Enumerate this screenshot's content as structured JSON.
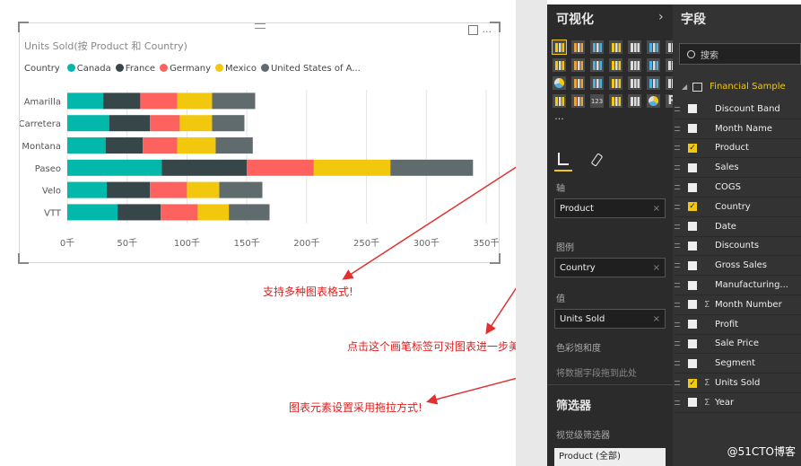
{
  "card": {
    "title": "Units Sold(按 Product 和 Country)",
    "legend_label": "Country",
    "legend": [
      {
        "name": "Canada",
        "color": "#01b8aa"
      },
      {
        "name": "France",
        "color": "#374649"
      },
      {
        "name": "Germany",
        "color": "#fd625e"
      },
      {
        "name": "Mexico",
        "color": "#f2c80f"
      },
      {
        "name": "United States of A...",
        "color": "#5f6b6d"
      }
    ],
    "focus_icon": "focus-mode-icon",
    "more_label": "···"
  },
  "chart_data": {
    "type": "bar",
    "orientation": "horizontal",
    "stacked": true,
    "categories": [
      "Amarilla",
      "Carretera",
      "Montana",
      "Paseo",
      "Velo",
      "VTT"
    ],
    "series": [
      {
        "name": "Canada",
        "color": "#01b8aa",
        "values": [
          30,
          35,
          32,
          79,
          33,
          42
        ]
      },
      {
        "name": "France",
        "color": "#374649",
        "values": [
          31,
          34,
          31,
          71,
          36,
          36
        ]
      },
      {
        "name": "Germany",
        "color": "#fd625e",
        "values": [
          31,
          25,
          29,
          56,
          31,
          31
        ]
      },
      {
        "name": "Mexico",
        "color": "#f2c80f",
        "values": [
          29,
          27,
          32,
          64,
          27,
          26
        ]
      },
      {
        "name": "United States of America",
        "color": "#5f6b6d",
        "values": [
          36,
          27,
          31,
          69,
          36,
          34
        ]
      }
    ],
    "xlim": [
      0,
      350
    ],
    "xticks": [
      "0千",
      "50千",
      "100千",
      "150千",
      "200千",
      "250千",
      "300千",
      "350千"
    ],
    "grid": true
  },
  "annotations": {
    "a1": "支持多种图表格式!",
    "a2": "点击这个画笔标签可对图表进一步美化!",
    "a3": "图表元素设置采用拖拉方式!"
  },
  "viz_pane": {
    "title": "可视化",
    "chevron": "›",
    "axis_label": "轴",
    "axis_value": "Product",
    "legend_label": "图例",
    "legend_value": "Country",
    "value_label": "值",
    "value_value": "Units Sold",
    "saturation_label": "色彩饱和度",
    "drop_hint": "将数据字段拖到此处",
    "filters_title": "筛选器",
    "visual_filters": "视觉级筛选器",
    "filter_item": "Product (全部)",
    "more_visuals": "···",
    "r_visual": "R",
    "table_visual": "123"
  },
  "fields_pane": {
    "title": "字段",
    "search_placeholder": "搜索",
    "table_name": "Financial Sample",
    "fields": [
      {
        "name": "Discount Band",
        "checked": false,
        "sigma": false
      },
      {
        "name": "Month Name",
        "checked": false,
        "sigma": false
      },
      {
        "name": "Product",
        "checked": true,
        "sigma": false
      },
      {
        "name": "Sales",
        "checked": false,
        "sigma": false
      },
      {
        "name": "COGS",
        "checked": false,
        "sigma": false
      },
      {
        "name": "Country",
        "checked": true,
        "sigma": false
      },
      {
        "name": "Date",
        "checked": false,
        "sigma": false
      },
      {
        "name": "Discounts",
        "checked": false,
        "sigma": false
      },
      {
        "name": "Gross Sales",
        "checked": false,
        "sigma": false
      },
      {
        "name": "Manufacturing...",
        "checked": false,
        "sigma": false
      },
      {
        "name": "Month Number",
        "checked": false,
        "sigma": true
      },
      {
        "name": "Profit",
        "checked": false,
        "sigma": false
      },
      {
        "name": "Sale Price",
        "checked": false,
        "sigma": false
      },
      {
        "name": "Segment",
        "checked": false,
        "sigma": false
      },
      {
        "name": "Units Sold",
        "checked": true,
        "sigma": true
      },
      {
        "name": "Year",
        "checked": false,
        "sigma": true
      }
    ]
  },
  "watermark": "@51CTO博客",
  "colors": {
    "highlight": "#e03030",
    "accent": "#f2c811"
  }
}
